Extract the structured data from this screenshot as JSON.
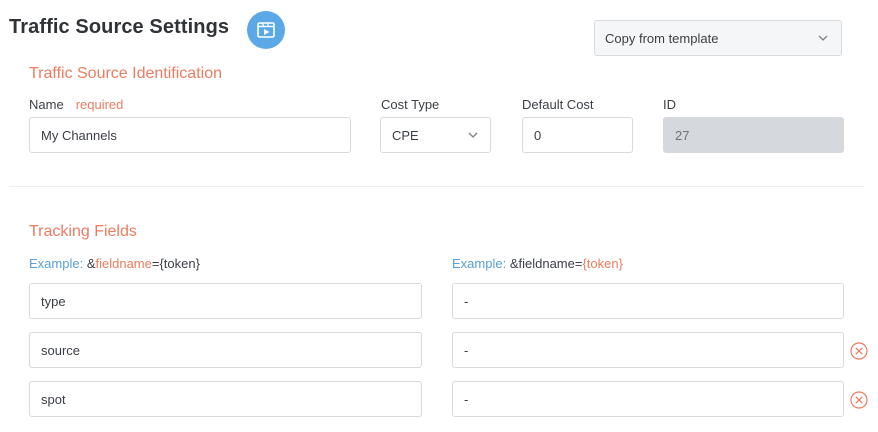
{
  "header": {
    "title": "Traffic Source Settings",
    "template_select": "Copy from template"
  },
  "identification": {
    "title": "Traffic Source Identification",
    "name_label": "Name",
    "required_label": "required",
    "name_value": "My Channels",
    "cost_type_label": "Cost Type",
    "cost_type_value": "CPE",
    "default_cost_label": "Default Cost",
    "default_cost_value": "0",
    "id_label": "ID",
    "id_value": "27"
  },
  "tracking": {
    "title": "Tracking Fields",
    "example_left": {
      "prefix": "Example:",
      "amp": " &",
      "name": "fieldname",
      "eq": "=",
      "token": "{token}"
    },
    "example_right": {
      "prefix": "Example:",
      "amp": " &",
      "name": "fieldname",
      "eq": "=",
      "token": "{token}"
    },
    "rows": [
      {
        "name": "type",
        "value": "-"
      },
      {
        "name": "source",
        "value": "-"
      },
      {
        "name": "spot",
        "value": "-"
      }
    ]
  },
  "colors": {
    "accent": "#ee7b5f",
    "link": "#5a9fd6",
    "badge": "#5aa9e6"
  },
  "icons": {
    "badge": "video-icon",
    "dropdown": "chevron-down-icon",
    "remove": "remove-circle-icon"
  }
}
